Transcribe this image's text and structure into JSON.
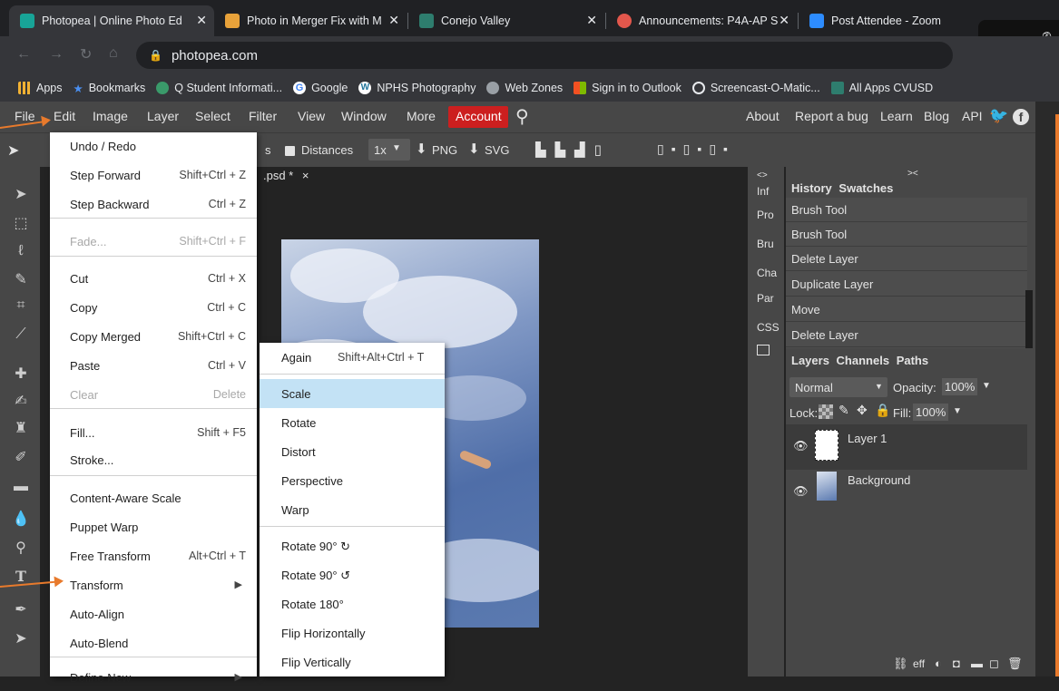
{
  "browser": {
    "tabs": [
      {
        "title": "Photopea | Online Photo Ed",
        "active": true,
        "favicon_color": "#18a497"
      },
      {
        "title": "Photo in Merger Fix with M",
        "active": false,
        "favicon_color": "#e8a23a"
      },
      {
        "title": "Conejo Valley",
        "active": false,
        "favicon_color": "#2e7d6e"
      },
      {
        "title": "Announcements: P4A-AP S",
        "active": false,
        "favicon_color": "#e2574c"
      },
      {
        "title": "Post Attendee - Zoom",
        "active": false,
        "favicon_color": "#2d8cff"
      }
    ],
    "url": "photopea.com",
    "bookmarks": [
      {
        "label": "Apps",
        "icon": "apps-grid-icon",
        "color": "#f2b233"
      },
      {
        "label": "Bookmarks",
        "icon": "star-icon",
        "color": "#4a8ff0"
      },
      {
        "label": "Q Student Informati...",
        "icon": "q-icon",
        "color": "#3a9a6a"
      },
      {
        "label": "Google",
        "icon": "google-icon",
        "color": "#ffffff"
      },
      {
        "label": "NPHS Photography",
        "icon": "wordpress-icon",
        "color": "#ffffff"
      },
      {
        "label": "Web Zones",
        "icon": "globe-icon",
        "color": "#9aa0a6"
      },
      {
        "label": "Sign in to Outlook",
        "icon": "microsoft-icon",
        "color": "#f25022"
      },
      {
        "label": "Screencast-O-Matic...",
        "icon": "screencast-icon",
        "color": "#1a73e8"
      },
      {
        "label": "All Apps CVUSD",
        "icon": "school-icon",
        "color": "#2e7d6e"
      }
    ]
  },
  "menubar": {
    "items": [
      "File",
      "Edit",
      "Image",
      "Layer",
      "Select",
      "Filter",
      "View",
      "Window",
      "More",
      "Account"
    ],
    "right_items": [
      "About",
      "Report a bug",
      "Learn",
      "Blog",
      "API"
    ],
    "account_color": "#cc1f1f"
  },
  "options_bar": {
    "trailing_label": "s",
    "distances": "Distances",
    "zoom": "1x",
    "png": "PNG",
    "svg": "SVG"
  },
  "document": {
    "tab_label": ".psd *",
    "close": "×"
  },
  "side_column": [
    "Inf",
    "Pro",
    "Bru",
    "Cha",
    "Par",
    "CSS"
  ],
  "history_panel": {
    "tabs": [
      "History",
      "Swatches"
    ],
    "items": [
      "Brush Tool",
      "Brush Tool",
      "Delete Layer",
      "Duplicate Layer",
      "Move",
      "Delete Layer"
    ]
  },
  "layers_panel": {
    "tabs": [
      "Layers",
      "Channels",
      "Paths"
    ],
    "blend_mode": "Normal",
    "opacity_label": "Opacity:",
    "opacity": "100%",
    "lock_label": "Lock:",
    "fill_label": "Fill:",
    "fill": "100%",
    "layers": [
      "Layer 1",
      "Background"
    ],
    "footer_text": "eff"
  },
  "edit_menu": {
    "items": [
      {
        "label": "Undo / Redo",
        "shortcut": "",
        "disabled": false
      },
      {
        "label": "Step Forward",
        "shortcut": "Shift+Ctrl + Z",
        "disabled": false
      },
      {
        "label": "Step Backward",
        "shortcut": "Ctrl + Z",
        "disabled": false
      },
      {
        "label": "Fade...",
        "shortcut": "Shift+Ctrl + F",
        "disabled": true
      },
      {
        "label": "Cut",
        "shortcut": "Ctrl + X",
        "disabled": false
      },
      {
        "label": "Copy",
        "shortcut": "Ctrl + C",
        "disabled": false
      },
      {
        "label": "Copy Merged",
        "shortcut": "Shift+Ctrl + C",
        "disabled": false
      },
      {
        "label": "Paste",
        "shortcut": "Ctrl + V",
        "disabled": false
      },
      {
        "label": "Clear",
        "shortcut": "Delete",
        "disabled": true
      },
      {
        "label": "Fill...",
        "shortcut": "Shift + F5",
        "disabled": false
      },
      {
        "label": "Stroke...",
        "shortcut": "",
        "disabled": false
      },
      {
        "label": "Content-Aware Scale",
        "shortcut": "",
        "disabled": false
      },
      {
        "label": "Puppet Warp",
        "shortcut": "",
        "disabled": false
      },
      {
        "label": "Free Transform",
        "shortcut": "Alt+Ctrl + T",
        "disabled": false
      },
      {
        "label": "Transform",
        "shortcut": "▶",
        "disabled": false
      },
      {
        "label": "Auto-Align",
        "shortcut": "",
        "disabled": false
      },
      {
        "label": "Auto-Blend",
        "shortcut": "",
        "disabled": false
      },
      {
        "label": "Define New",
        "shortcut": "▶",
        "disabled": false
      }
    ]
  },
  "transform_submenu": {
    "items": [
      {
        "label": "Again",
        "shortcut": "Shift+Alt+Ctrl + T"
      },
      {
        "label": "Scale",
        "shortcut": "",
        "highlighted": true
      },
      {
        "label": "Rotate",
        "shortcut": ""
      },
      {
        "label": "Distort",
        "shortcut": ""
      },
      {
        "label": "Perspective",
        "shortcut": ""
      },
      {
        "label": "Warp",
        "shortcut": ""
      },
      {
        "label": "Rotate 90° ↻",
        "shortcut": ""
      },
      {
        "label": "Rotate 90° ↺",
        "shortcut": ""
      },
      {
        "label": "Rotate 180°",
        "shortcut": ""
      },
      {
        "label": "Flip Horizontally",
        "shortcut": ""
      },
      {
        "label": "Flip Vertically",
        "shortcut": ""
      }
    ]
  },
  "annotation_color": "#e87a2c"
}
